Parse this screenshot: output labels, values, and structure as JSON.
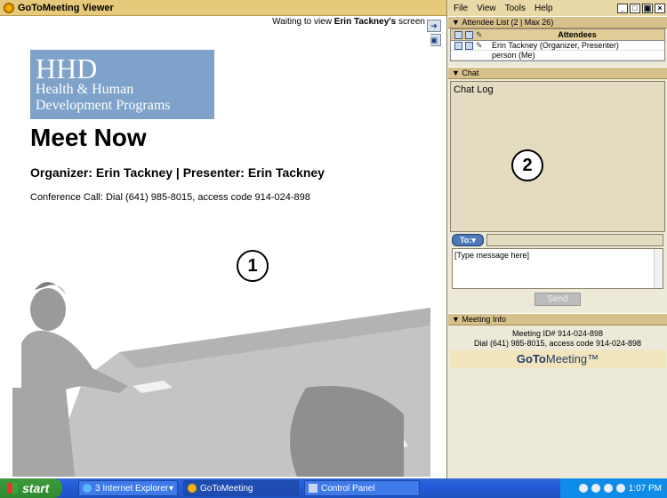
{
  "viewer": {
    "title": "GoToMeeting Viewer",
    "status_prefix": "Waiting to view ",
    "status_name": "Erin Tackney's",
    "status_suffix": " screen",
    "logo": {
      "line1": "HHD",
      "line2": "Health & Human",
      "line3": "Development Programs"
    },
    "heading": "Meet Now",
    "organizer_line": "Organizer: Erin Tackney  |  Presenter: Erin Tackney",
    "conference_line": "Conference Call: Dial (641) 985-8015, access code 914-024-898",
    "badge": "1"
  },
  "panel": {
    "menu": [
      "File",
      "View",
      "Tools",
      "Help"
    ],
    "attendee_section": "Attendee List  (2 | Max 26)",
    "attendees_header": "Attendees",
    "attendees": [
      {
        "name": "Erin Tackney (Organizer, Presenter)"
      },
      {
        "name": "person (Me)"
      }
    ],
    "chat_section": "Chat",
    "chat_log_label": "Chat Log",
    "badge": "2",
    "to_button": "To:",
    "message_placeholder": "[Type message here]",
    "send_label": "Send",
    "meeting_info_section": "Meeting Info",
    "meeting_id": "Meeting ID# 914-024-898",
    "meeting_dial": "Dial (641) 985-8015, access code 914-024-898",
    "brand_bold": "GoTo",
    "brand_rest": "Meeting™"
  },
  "taskbar": {
    "start": "start",
    "tasks": [
      "3 Internet Explorer",
      "GoToMeeting",
      "Control Panel"
    ],
    "clock": "1:07 PM"
  },
  "colors": {
    "title_bar": "#e6c97a",
    "hhd_logo": "#7ea2c9",
    "taskbar": "#245edb",
    "start_button": "#3c9a3c"
  }
}
